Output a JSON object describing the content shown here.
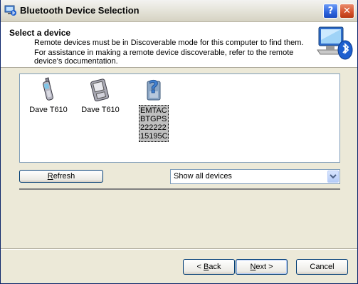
{
  "window": {
    "title": "Bluetooth Device Selection",
    "help_label": "?",
    "close_label": "✕"
  },
  "header": {
    "title": "Select a device",
    "line1": "Remote devices must be in Discoverable mode for this computer to find them.",
    "line2": "For assistance in making a remote device discoverable, refer to the remote",
    "line3": "device's documentation."
  },
  "devices": [
    {
      "name": "Dave T610",
      "icon": "mobile-phone-icon",
      "selected": false
    },
    {
      "name": "Dave T610",
      "icon": "pda-icon",
      "selected": false
    },
    {
      "name": "EMTAC BTGPS 222222 15195C",
      "label_lines": [
        "EMTAC",
        "BTGPS",
        "222222",
        "15195C"
      ],
      "icon": "unknown-device-icon",
      "selected": true
    }
  ],
  "controls": {
    "refresh_label_first": "R",
    "refresh_label_rest": "efresh",
    "filter_value": "Show all devices"
  },
  "buttons": {
    "back_prefix": "< ",
    "back_accel": "B",
    "back_rest": "ack",
    "next_accel": "N",
    "next_rest": "ext >",
    "cancel_label": "Cancel"
  },
  "colors": {
    "accent": "#0a246a",
    "selection": "#c0c0c0",
    "face": "#ece9d8"
  }
}
